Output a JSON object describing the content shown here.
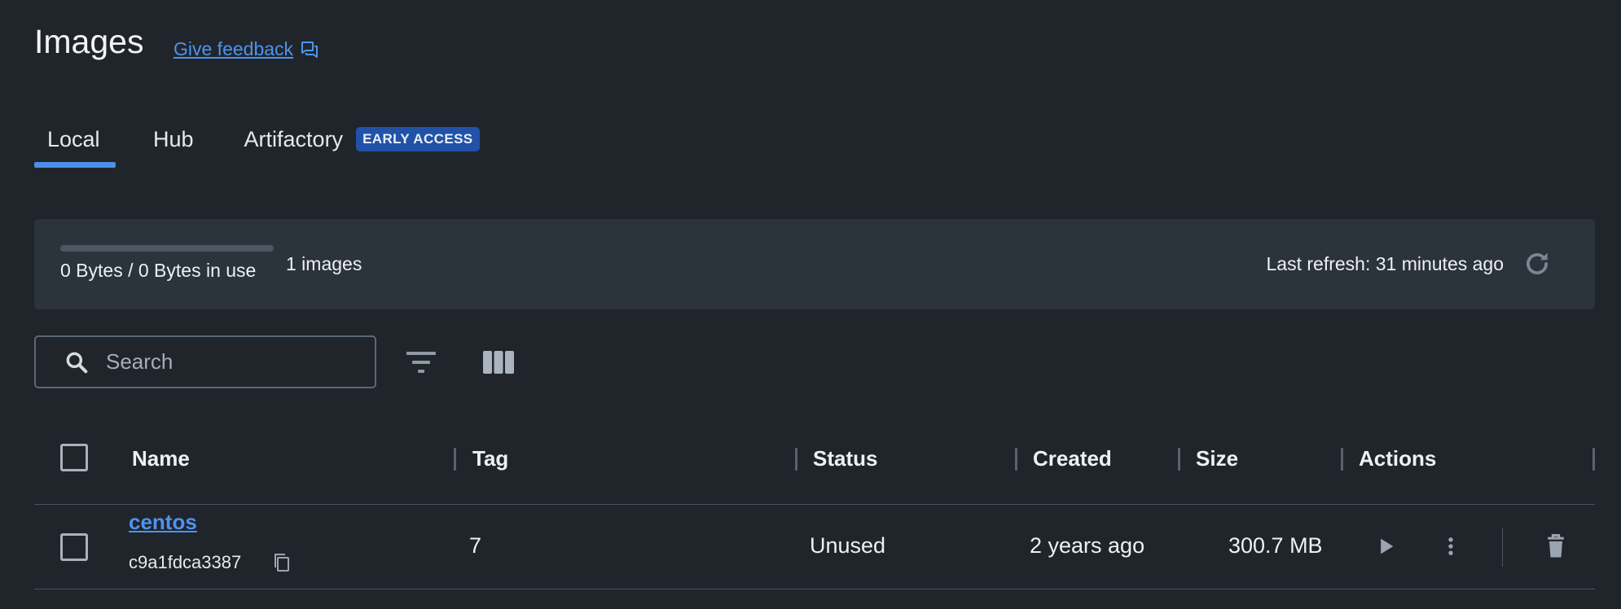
{
  "header": {
    "title": "Images",
    "feedback_label": "Give feedback"
  },
  "tabs": [
    {
      "label": "Local",
      "active": true
    },
    {
      "label": "Hub",
      "active": false
    },
    {
      "label": "Artifactory",
      "active": false,
      "badge": "EARLY ACCESS"
    }
  ],
  "usage": {
    "text": "0 Bytes / 0 Bytes in use",
    "fraction_used": 0,
    "images_count": "1 images",
    "last_refresh": "Last refresh: 31 minutes ago"
  },
  "toolbar": {
    "search_placeholder": "Search"
  },
  "table": {
    "columns": [
      "Name",
      "Tag",
      "Status",
      "Created",
      "Size",
      "Actions"
    ],
    "rows": [
      {
        "name": "centos",
        "id": "c9a1fdca3387",
        "tag": "7",
        "status": "Unused",
        "created": "2 years ago",
        "size": "300.7 MB"
      }
    ]
  },
  "icons": {
    "feedback": "feedback-icon",
    "refresh": "refresh-icon",
    "search": "search-icon",
    "filter": "filter-icon",
    "columns": "columns-icon",
    "copy": "copy-icon",
    "run": "play-icon",
    "more": "more-vertical-icon",
    "delete": "trash-icon"
  },
  "colors": {
    "background": "#20252b",
    "panel": "#2b333b",
    "accent": "#4f8ee8",
    "link": "#4e93ef",
    "badge": "#2152a8"
  }
}
